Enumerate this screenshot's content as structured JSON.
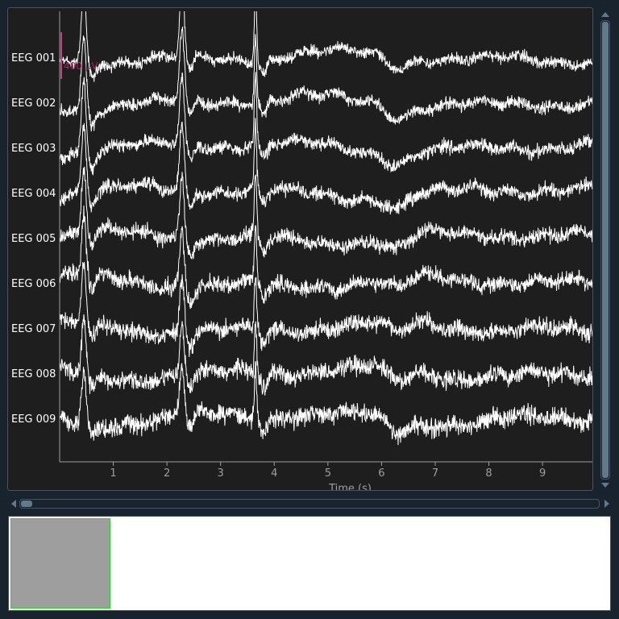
{
  "colors": {
    "background": "#19232d",
    "plot_bg": "#1e1e1e",
    "trace": "#ffffff",
    "axis": "#9e9e9e",
    "scale_bar": "#c2427d",
    "overview_window": "#9e9e9e",
    "overview_border": "#2bd22b"
  },
  "chart_data": {
    "type": "line",
    "xlabel": "Time (s)",
    "xlim": [
      0,
      9.93
    ],
    "x_ticks": [
      "1",
      "2",
      "3",
      "4",
      "5",
      "6",
      "7",
      "8",
      "9"
    ],
    "channels": [
      "EEG 001",
      "EEG 002",
      "EEG 003",
      "EEG 004",
      "EEG 005",
      "EEG 006",
      "EEG 007",
      "EEG 008",
      "EEG 009"
    ],
    "scale_bar_label": "400 µV",
    "blink_artifacts_s": [
      0.45,
      2.28,
      3.65
    ],
    "slow_dip_s": 6.3
  },
  "overview": {
    "window_start_fraction": 0.0,
    "window_end_fraction": 0.167
  },
  "vertical_scroll": {
    "position_fraction": 0.0,
    "visible_fraction": 1.0
  },
  "horizontal_scroll": {
    "position_fraction": 0.0
  }
}
